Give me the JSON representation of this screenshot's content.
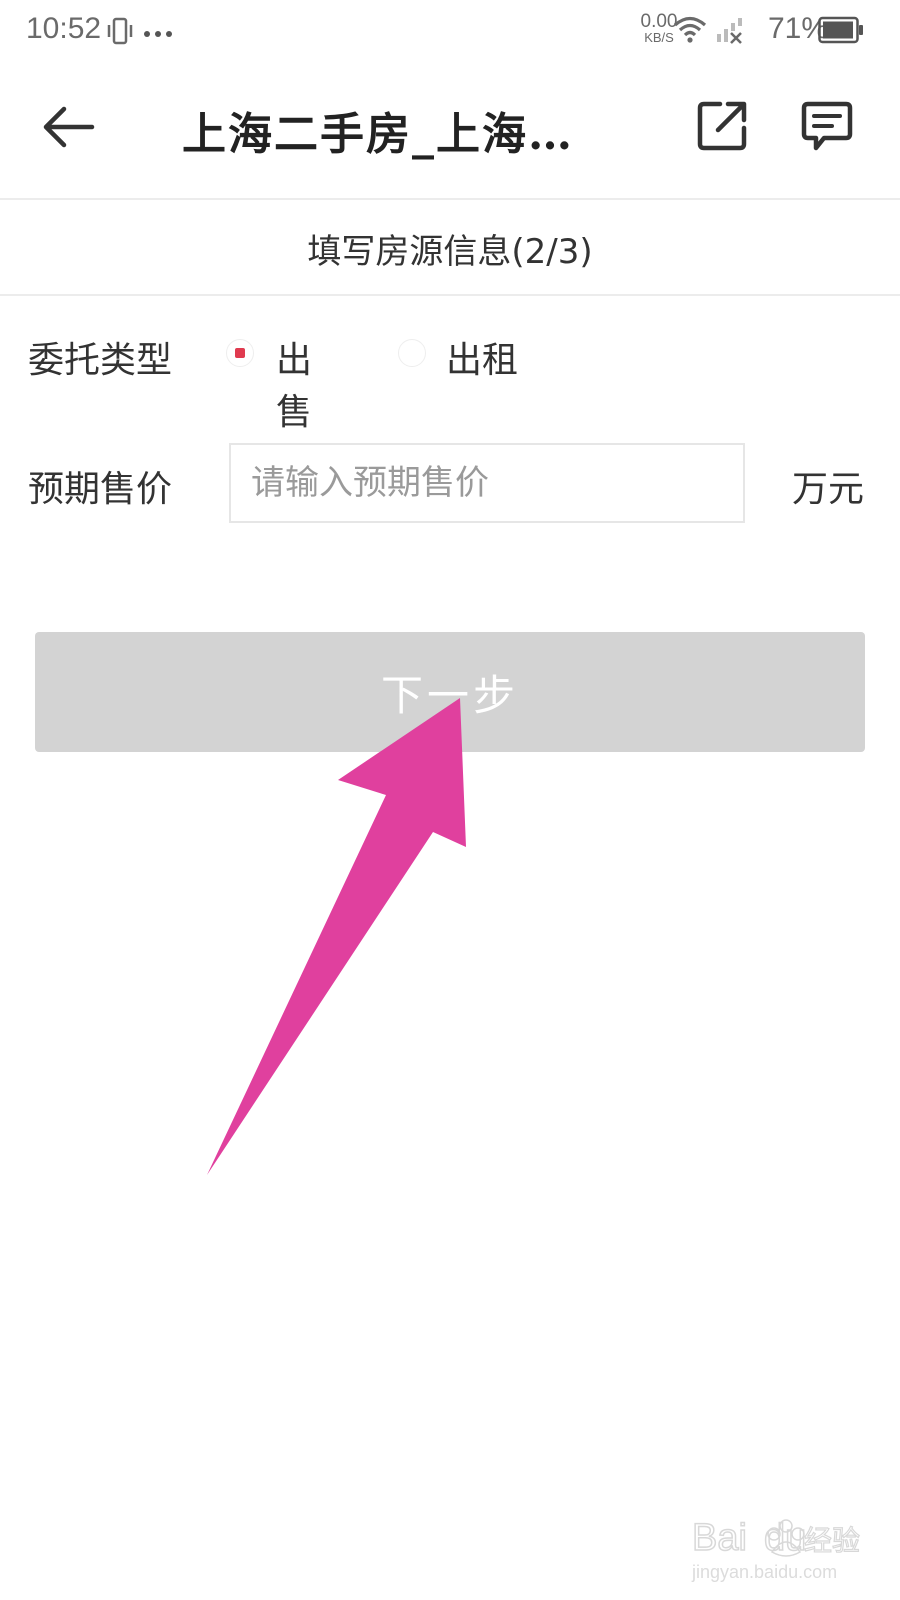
{
  "status_bar": {
    "time": "10:52",
    "net_speed": "0.00",
    "net_unit": "KB/S",
    "battery_pct": "71%",
    "icons": [
      "vibrate-icon",
      "more-dots-icon",
      "wifi-icon",
      "signal-no-service-icon",
      "battery-icon"
    ]
  },
  "header": {
    "title": "上海二手房_上海…",
    "back_icon": "arrow-left-icon",
    "share_icon": "share-external-icon",
    "message_icon": "chat-message-icon"
  },
  "form": {
    "step_title": "填写房源信息(2/3)",
    "entrust_type_label": "委托类型",
    "options": [
      {
        "label": "出售",
        "selected": true
      },
      {
        "label": "出租",
        "selected": false
      }
    ],
    "price_label": "预期售价",
    "price_placeholder": "请输入预期售价",
    "price_value": "",
    "price_unit": "万元",
    "next_label": "下一步"
  },
  "colors": {
    "radio_selected": "#e03a4f",
    "button_disabled": "#d3d3d3",
    "annotation_arrow": "#e0409e"
  },
  "watermark": {
    "brand": "Baidu经验",
    "url": "jingyan.baidu.com"
  }
}
